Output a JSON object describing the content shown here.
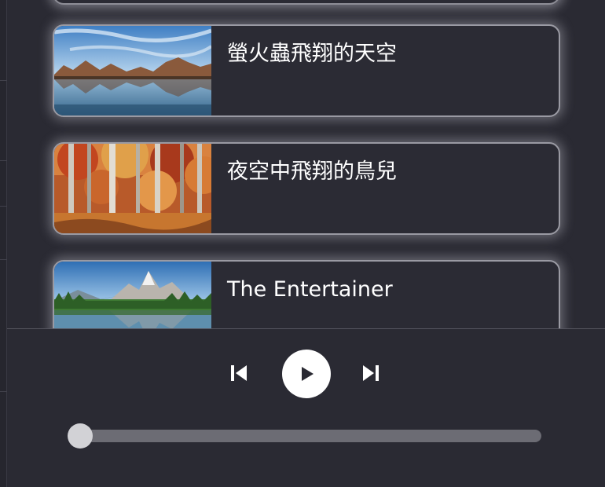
{
  "playlist": {
    "items": [
      {
        "title": "螢火蟲飛翔的天空",
        "thumbnail": "lake-mountains-image"
      },
      {
        "title": "夜空中飛翔的鳥兒",
        "thumbnail": "autumn-forest-image"
      },
      {
        "title": "The Entertainer",
        "thumbnail": "alpine-lake-image"
      }
    ]
  },
  "player": {
    "controls": {
      "previous_icon": "skip-previous-icon",
      "play_icon": "play-icon",
      "next_icon": "skip-next-icon"
    },
    "progress": 0
  },
  "colors": {
    "background": "#2a2a33",
    "card_border": "#9a9aa3",
    "text": "#ffffff",
    "track": "#6c6c74",
    "thumb": "#d2d2d6"
  }
}
